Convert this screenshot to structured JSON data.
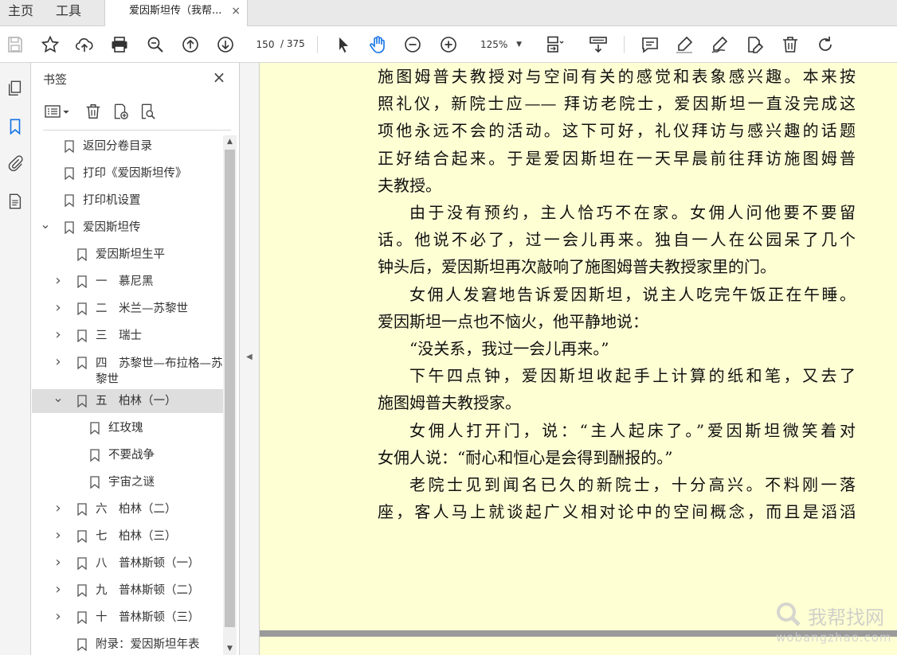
{
  "tabs": {
    "home": "主页",
    "tools": "工具",
    "document": "爱因斯坦传（我帮...",
    "close": "×"
  },
  "toolbar": {
    "icons": [
      "save-icon",
      "star-icon",
      "upload-icon",
      "print-icon",
      "zoom-out-find-icon",
      "page-up-icon",
      "page-down-icon",
      "select-arrow-icon",
      "hand-icon",
      "zoom-minus-icon",
      "zoom-plus-icon",
      "fit-page-icon",
      "scroll-mode-icon",
      "comment-icon",
      "highlight-icon",
      "sign-icon",
      "fill-sign-icon",
      "delete-icon",
      "rotate-icon"
    ],
    "page_current": "150",
    "page_total": "/ 375",
    "zoom": "125%"
  },
  "panel": {
    "title": "书签",
    "close": "×",
    "bookmarks": [
      {
        "label": "返回分卷目录",
        "level": 0,
        "toggle": ""
      },
      {
        "label": "打印《爱因斯坦传》",
        "level": 0,
        "toggle": ""
      },
      {
        "label": "打印机设置",
        "level": 0,
        "toggle": ""
      },
      {
        "label": "爱因斯坦传",
        "level": 0,
        "toggle": "expanded"
      },
      {
        "label": "爱因斯坦生平",
        "level": 1,
        "toggle": ""
      },
      {
        "label": "一　慕尼黑",
        "level": 1,
        "toggle": "collapsed"
      },
      {
        "label": "二　米兰—苏黎世",
        "level": 1,
        "toggle": "collapsed"
      },
      {
        "label": "三　瑞士",
        "level": 1,
        "toggle": "collapsed"
      },
      {
        "label": "四　苏黎世—布拉格—苏黎世",
        "level": 1,
        "toggle": "collapsed"
      },
      {
        "label": "五　柏林（一）",
        "level": 1,
        "toggle": "expanded"
      },
      {
        "label": "红玫瑰",
        "level": 2,
        "toggle": ""
      },
      {
        "label": "不要战争",
        "level": 2,
        "toggle": ""
      },
      {
        "label": "宇宙之谜",
        "level": 2,
        "toggle": ""
      },
      {
        "label": "六　柏林（二）",
        "level": 1,
        "toggle": "collapsed"
      },
      {
        "label": "七　柏林（三）",
        "level": 1,
        "toggle": "collapsed"
      },
      {
        "label": "八　普林斯顿（一）",
        "level": 1,
        "toggle": "collapsed"
      },
      {
        "label": "九　普林斯顿（二）",
        "level": 1,
        "toggle": "collapsed"
      },
      {
        "label": "十　普林斯顿（三）",
        "level": 1,
        "toggle": "collapsed"
      },
      {
        "label": "附录：爱因斯坦年表",
        "level": 1,
        "toggle": ""
      }
    ]
  },
  "document": {
    "lines": [
      {
        "text": "施图姆普夫教授对与空间有关的感觉和表象感兴趣。本来按",
        "indent": false,
        "justify": true
      },
      {
        "text": "照礼仪，新院士应—— 拜访老院士，爱因斯坦一直没完成这",
        "indent": false,
        "justify": true
      },
      {
        "text": "项他永远不会的活动。这下可好，礼仪拜访与感兴趣的话题",
        "indent": false,
        "justify": true
      },
      {
        "text": "正好结合起来。于是爱因斯坦在一天早晨前往拜访施图姆普",
        "indent": false,
        "justify": true
      },
      {
        "text": "夫教授。",
        "indent": false,
        "justify": false
      },
      {
        "text": "由于没有预约，主人恰巧不在家。女佣人问他要不要留",
        "indent": true,
        "justify": true
      },
      {
        "text": "话。他说不必了，过一会儿再来。独自一人在公园呆了几个",
        "indent": false,
        "justify": true
      },
      {
        "text": "钟头后，爱因斯坦再次敲响了施图姆普夫教授家里的门。",
        "indent": false,
        "justify": false
      },
      {
        "text": "女佣人发窘地告诉爱因斯坦，说主人吃完午饭正在午睡。",
        "indent": true,
        "justify": true
      },
      {
        "text": "爱因斯坦一点也不恼火，他平静地说：",
        "indent": false,
        "justify": false
      },
      {
        "text": "“没关系，我过一会儿再来。”",
        "indent": true,
        "justify": false
      },
      {
        "text": "下午四点钟，爱因斯坦收起手上计算的纸和笔，又去了",
        "indent": true,
        "justify": true
      },
      {
        "text": "施图姆普夫教授家。",
        "indent": false,
        "justify": false
      },
      {
        "text": "女佣人打开门，说：“主人起床了。”爱因斯坦微笑着对",
        "indent": true,
        "justify": true
      },
      {
        "text": "女佣人说：“耐心和恒心是会得到酬报的。”",
        "indent": false,
        "justify": false
      },
      {
        "text": "老院士见到闻名已久的新院士，十分高兴。不料刚一落",
        "indent": true,
        "justify": true
      },
      {
        "text": "座，客人马上就谈起广义相对论中的空间概念，而且是滔滔",
        "indent": false,
        "justify": true
      }
    ]
  },
  "watermark": {
    "main": "我帮找网",
    "sub": "wobangzhao.com"
  },
  "colors": {
    "page_bg": "#ffffd4",
    "accent_blue": "#1473e6",
    "selected_bg": "#dedede"
  }
}
